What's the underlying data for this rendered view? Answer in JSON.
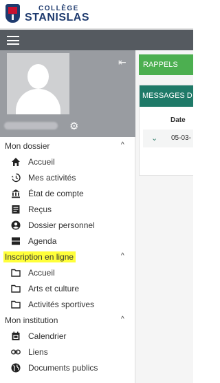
{
  "header": {
    "logo_top": "COLLÈGE",
    "logo_bottom": "STANISLAS"
  },
  "topbar": {
    "menu_icon": "hamburger-icon"
  },
  "profile": {
    "collapse_icon": "collapse-left-icon",
    "settings_icon": "gear-icon"
  },
  "sidebar": {
    "sections": [
      {
        "label": "Mon dossier",
        "highlighted": false,
        "items": [
          {
            "label": "Accueil",
            "icon": "home-icon"
          },
          {
            "label": "Mes activités",
            "icon": "history-icon"
          },
          {
            "label": "État de compte",
            "icon": "bank-icon"
          },
          {
            "label": "Reçus",
            "icon": "receipt-icon"
          },
          {
            "label": "Dossier personnel",
            "icon": "account-icon"
          },
          {
            "label": "Agenda",
            "icon": "agenda-icon"
          }
        ]
      },
      {
        "label": "Inscription en ligne",
        "highlighted": true,
        "items": [
          {
            "label": "Accueil",
            "icon": "folder-icon"
          },
          {
            "label": "Arts et culture",
            "icon": "folder-icon"
          },
          {
            "label": "Activités sportives",
            "icon": "folder-icon"
          }
        ]
      },
      {
        "label": "Mon institution",
        "highlighted": false,
        "items": [
          {
            "label": "Calendrier",
            "icon": "calendar-icon"
          },
          {
            "label": "Liens",
            "icon": "link-icon"
          },
          {
            "label": "Documents publics",
            "icon": "globe-icon"
          }
        ]
      }
    ]
  },
  "main": {
    "rappels_label": "RAPPELS",
    "messages_label": "MESSAGES D",
    "table_header_date": "Date",
    "row_date": "05-03-"
  },
  "colors": {
    "topbar": "#555a60",
    "rappels": "#4caf50",
    "messages": "#1f7a68",
    "highlight": "#ffff3a",
    "brand": "#1e3a6e"
  }
}
